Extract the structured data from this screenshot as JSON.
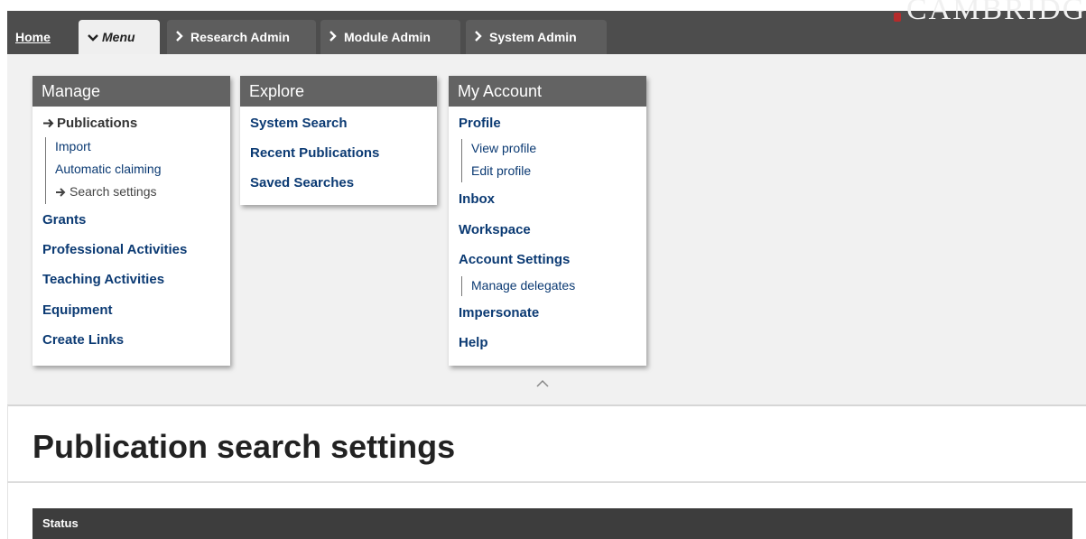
{
  "brand": {
    "logo_text": "CAMBRIDGE"
  },
  "nav": {
    "home_label": "Home",
    "menu_label": "Menu",
    "research_admin_label": "Research Admin",
    "module_admin_label": "Module Admin",
    "system_admin_label": "System Admin"
  },
  "menu": {
    "manage": {
      "title": "Manage",
      "publications": "Publications",
      "import": "Import",
      "automatic_claiming": "Automatic claiming",
      "search_settings": "Search settings",
      "grants": "Grants",
      "professional_activities": "Professional Activities",
      "teaching_activities": "Teaching Activities",
      "equipment": "Equipment",
      "create_links": "Create Links"
    },
    "explore": {
      "title": "Explore",
      "system_search": "System Search",
      "recent_publications": "Recent Publications",
      "saved_searches": "Saved Searches"
    },
    "my_account": {
      "title": "My Account",
      "profile": "Profile",
      "view_profile": "View profile",
      "edit_profile": "Edit profile",
      "inbox": "Inbox",
      "workspace": "Workspace",
      "account_settings": "Account Settings",
      "manage_delegates": "Manage delegates",
      "impersonate": "Impersonate",
      "help": "Help"
    }
  },
  "page": {
    "title": "Publication search settings",
    "status_heading": "Status"
  },
  "icons": {
    "chevron_right": "chevron-right-icon",
    "chevron_down": "chevron-down-icon",
    "arrow_right": "arrow-right-icon",
    "chevron_up": "chevron-up-icon"
  },
  "colors": {
    "topbar": "#4d4d4d",
    "panel_header": "#636363",
    "link": "#0b3a73",
    "status_bar": "#3d3d3d"
  }
}
